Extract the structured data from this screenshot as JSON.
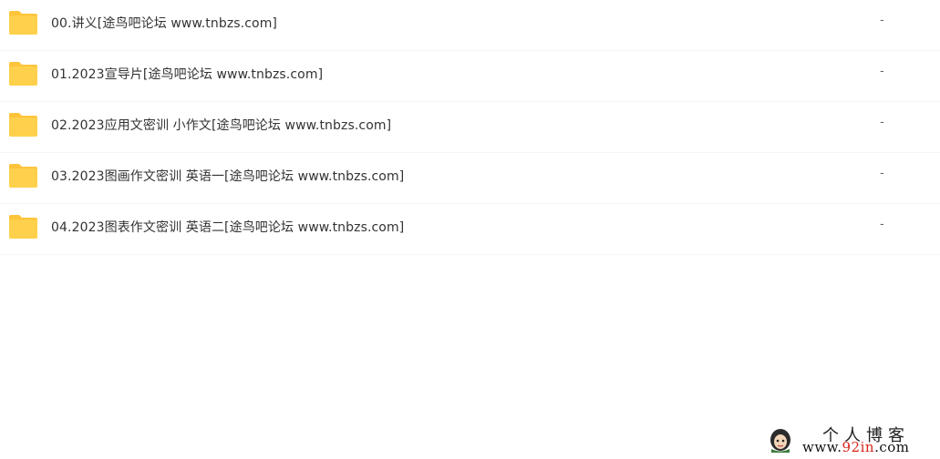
{
  "file_list": {
    "items": [
      {
        "name": "00.讲义[途鸟吧论坛 www.tnbzs.com]",
        "size": "-",
        "icon": "folder-icon"
      },
      {
        "name": "01.2023宣导片[途鸟吧论坛 www.tnbzs.com]",
        "size": "-",
        "icon": "folder-icon"
      },
      {
        "name": "02.2023应用文密训 小作文[途鸟吧论坛 www.tnbzs.com]",
        "size": "-",
        "icon": "folder-icon"
      },
      {
        "name": "03.2023图画作文密训 英语一[途鸟吧论坛 www.tnbzs.com]",
        "size": "-",
        "icon": "folder-icon"
      },
      {
        "name": "04.2023图表作文密训 英语二[途鸟吧论坛 www.tnbzs.com]",
        "size": "-",
        "icon": "folder-icon"
      }
    ]
  },
  "watermark": {
    "title": "个人博客",
    "url_prefix": "www.",
    "url_accent": "92in",
    "url_suffix": ".com",
    "icon": "avatar-icon"
  },
  "colors": {
    "folder_body": "#FFD04B",
    "folder_tab": "#FFC43A",
    "text": "#333333",
    "size_text": "#666666",
    "watermark_accent": "#D9261C"
  }
}
